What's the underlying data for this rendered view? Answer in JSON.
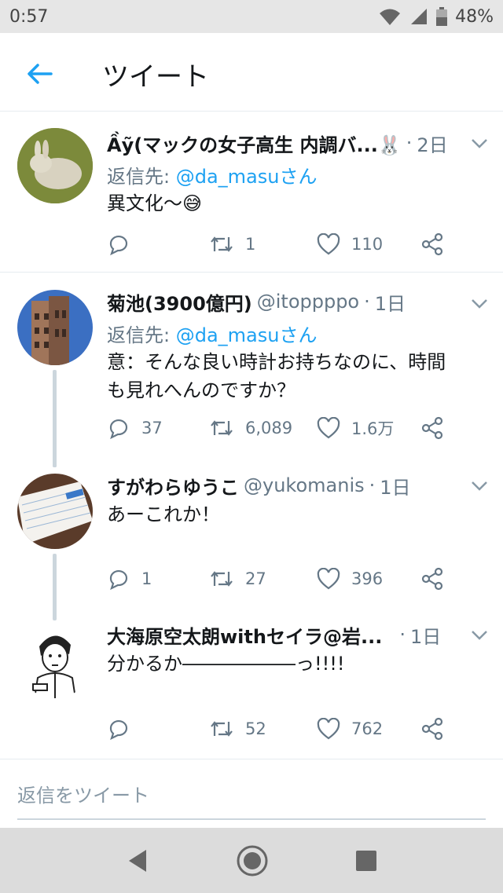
{
  "status": {
    "time": "0:57",
    "battery": "48%"
  },
  "header": {
    "title": "ツイート"
  },
  "tweets": [
    {
      "name": "Ầỹ(マックの女子高生 内調バ...🐰",
      "handle": "",
      "time": "2日",
      "reply_prefix": "返信先: ",
      "reply_to": "@da_masuさん",
      "text": "異文化〜😅",
      "replies": "",
      "retweets": "1",
      "likes": "110",
      "avatar": "rabbit-avatar"
    },
    {
      "name": "菊池(3900億円)",
      "handle": "@itoppppo",
      "time": "1日",
      "reply_prefix": "返信先: ",
      "reply_to": "@da_masuさん",
      "text": "意：そんな良い時計お持ちなのに、時間\nも見れへんのですか？",
      "replies": "37",
      "retweets": "6,089",
      "likes": "1.6万",
      "avatar": "tower-avatar"
    },
    {
      "name": "すがわらゆうこ",
      "handle": "@yukomanis",
      "time": "1日",
      "text": "あーこれか！",
      "replies": "1",
      "retweets": "27",
      "likes": "396",
      "avatar": "notebook-avatar"
    },
    {
      "name": "大海原空太朗withセイラ@岩...",
      "handle": "",
      "time": "1日",
      "text": "分かるか――――――っ!!!!",
      "replies": "",
      "retweets": "52",
      "likes": "762",
      "avatar": "cartoon-man-avatar"
    }
  ],
  "reply_box": {
    "placeholder": "返信をツイート"
  },
  "colors": {
    "accent": "#1da1f2",
    "secondary": "#657786",
    "line": "#ccd6dd"
  }
}
